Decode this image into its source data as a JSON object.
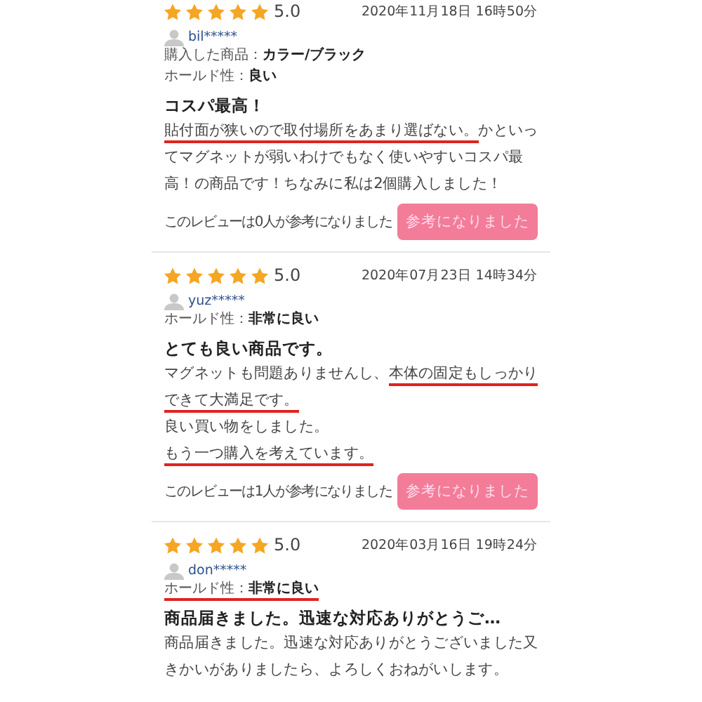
{
  "reviews": [
    {
      "stars": 5,
      "rating": "5.0",
      "date": "2020年11月18日 16時50分",
      "user": "bil*****",
      "attributes": [
        {
          "label": "購入した商品：",
          "value": "カラー/ブラック",
          "underlined": false
        },
        {
          "label": "ホールド性：",
          "value": "良い",
          "underlined": false
        }
      ],
      "title": "コスパ最高！",
      "body": [
        [
          {
            "text": "貼付面が狭いので取付場所をあまり選ばない。",
            "underlined": true
          },
          {
            "text": "かといっ",
            "underlined": false
          }
        ],
        [
          {
            "text": "てマグネットが弱いわけでもなく使いやすいコスパ最",
            "underlined": false
          }
        ],
        [
          {
            "text": "高！の商品です！ちなみに私は2個購入しました！",
            "underlined": false
          }
        ]
      ],
      "helpful": {
        "count_text": "このレビューは0人が参考になりました",
        "button": "参考になりました"
      }
    },
    {
      "stars": 5,
      "rating": "5.0",
      "date": "2020年07月23日 14時34分",
      "user": "yuz*****",
      "attributes": [
        {
          "label": "ホールド性：",
          "value": "非常に良い",
          "underlined": false
        }
      ],
      "title": "とても良い商品です。",
      "body": [
        [
          {
            "text": "マグネットも問題ありませんし、",
            "underlined": false
          },
          {
            "text": "本体の固定もしっかり",
            "underlined": true
          }
        ],
        [
          {
            "text": "できて大満足です。",
            "underlined": true
          }
        ],
        [
          {
            "text": "良い買い物をしました。",
            "underlined": false
          }
        ],
        [
          {
            "text": "もう一つ購入を考えています。",
            "underlined": true
          }
        ]
      ],
      "helpful": {
        "count_text": "このレビューは1人が参考になりました",
        "button": "参考になりました"
      }
    },
    {
      "stars": 5,
      "rating": "5.0",
      "date": "2020年03月16日 19時24分",
      "user": "don*****",
      "attributes": [
        {
          "label": "ホールド性：",
          "value": "非常に良い",
          "underlined": true
        }
      ],
      "title": "商品届きました。迅速な対応ありがとうご…",
      "body": [
        [
          {
            "text": "商品届きました。迅速な対応ありがとうございました又",
            "underlined": false
          }
        ],
        [
          {
            "text": "きかいがありましたら、よろしくおねがいします。",
            "underlined": false
          }
        ]
      ]
    }
  ]
}
